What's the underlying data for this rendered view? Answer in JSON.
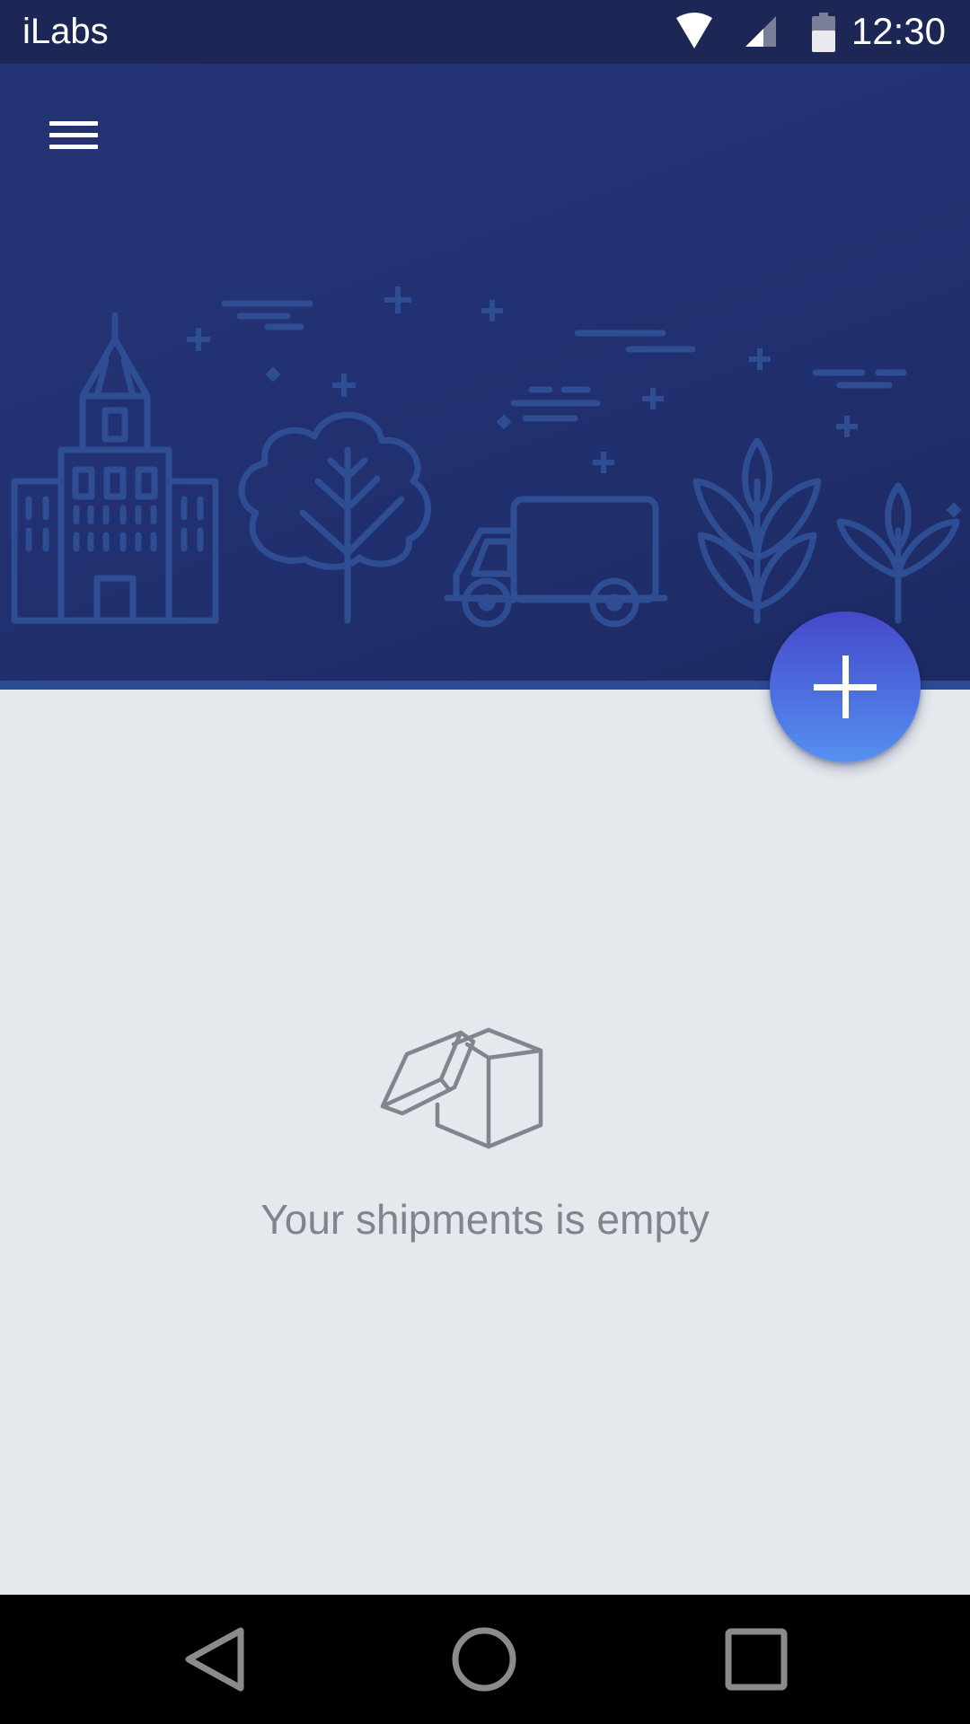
{
  "status_bar": {
    "app_name": "iLabs",
    "time": "12:30",
    "icons": [
      "wifi-icon",
      "cell-signal-icon",
      "battery-icon"
    ]
  },
  "header": {
    "menu_icon": "hamburger-menu-icon",
    "illustration": "city-skyline-illustration",
    "background_color": "#223172"
  },
  "fab": {
    "icon": "plus-icon",
    "color": "#4d6fe0"
  },
  "empty_state": {
    "icon": "open-box-icon",
    "message": "Your shipments is empty"
  },
  "nav_bar": {
    "buttons": [
      "back-icon",
      "home-icon",
      "recents-icon"
    ]
  }
}
